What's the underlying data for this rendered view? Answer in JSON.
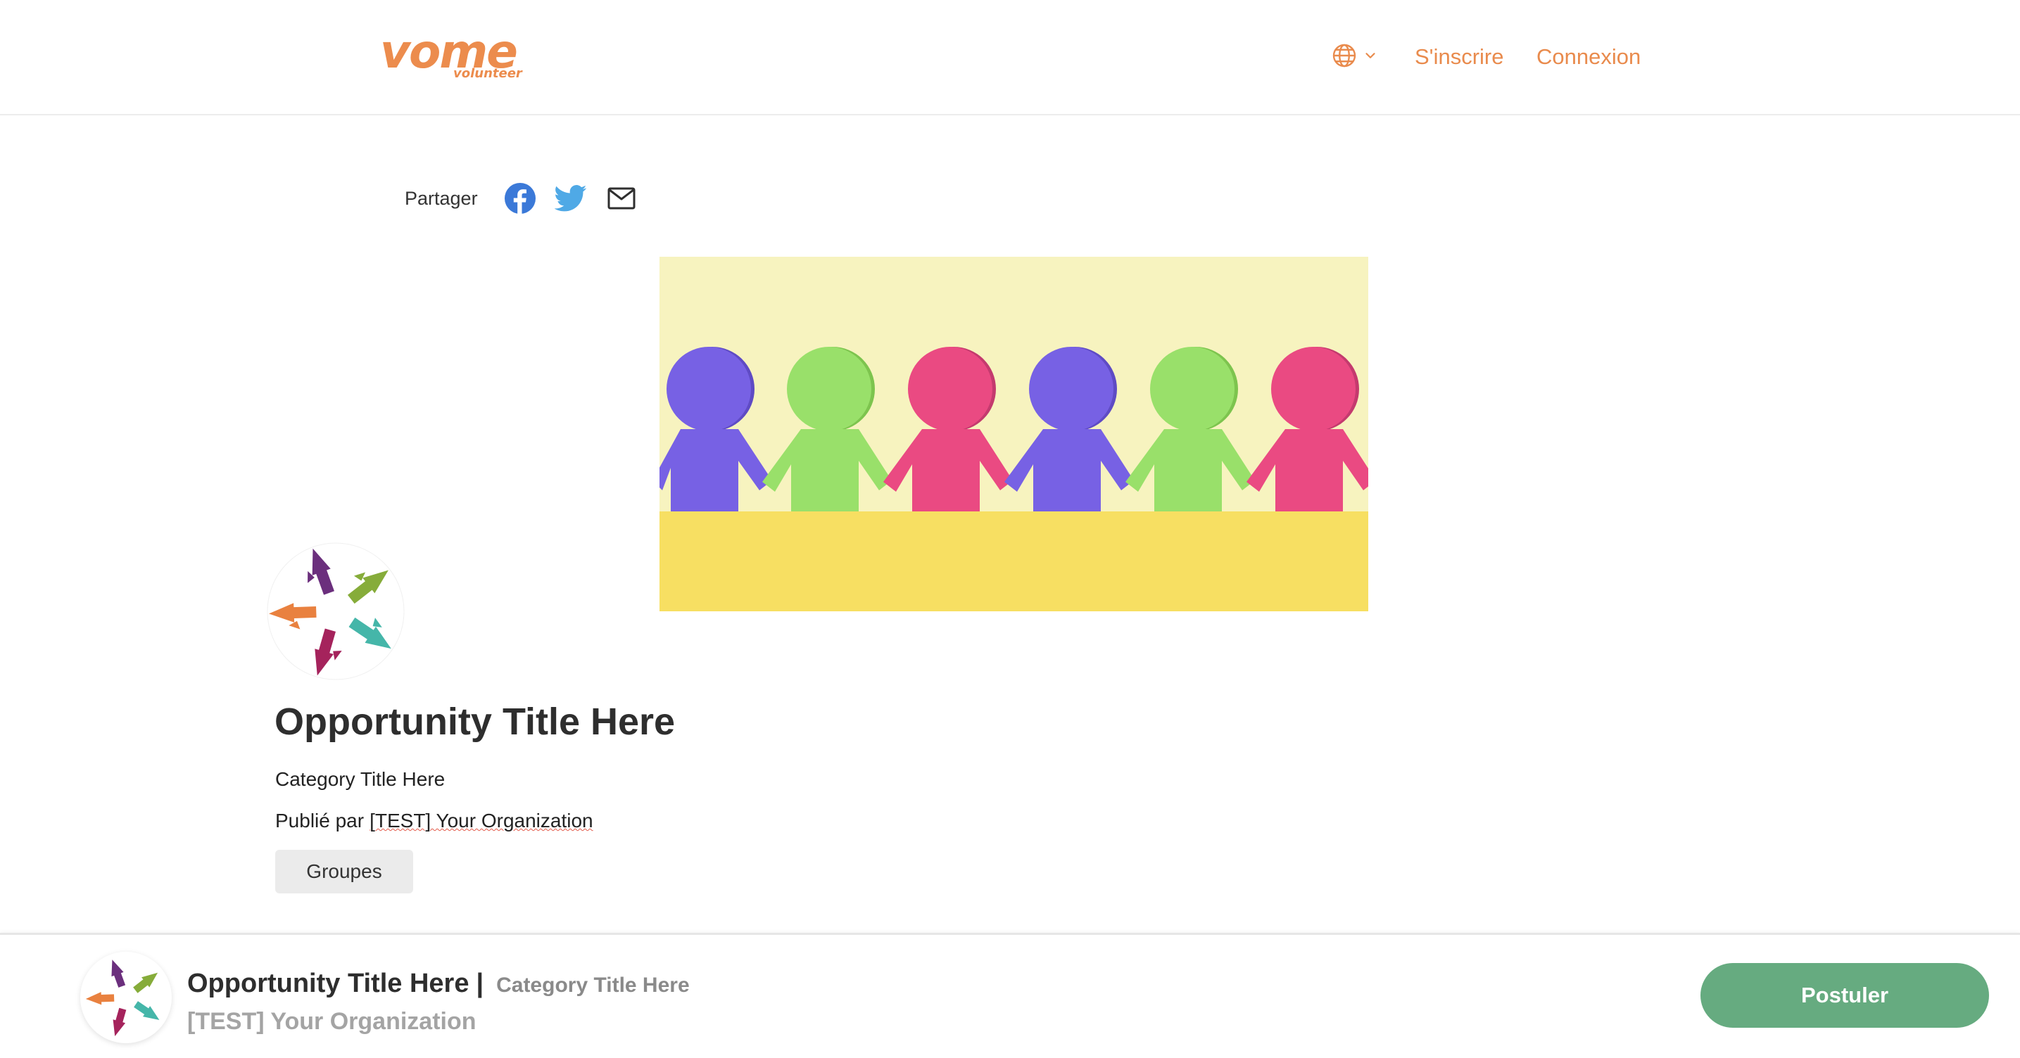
{
  "header": {
    "logo_text": "vome",
    "logo_subtext": "volunteer",
    "language_icon": "globe-icon",
    "signup_label": "S'inscrire",
    "login_label": "Connexion"
  },
  "share": {
    "label": "Partager",
    "icons": [
      "facebook-icon",
      "twitter-icon",
      "mail-icon"
    ]
  },
  "opportunity": {
    "title": "Opportunity Title Here",
    "category": "Category Title Here",
    "published_by_label": "Publié par",
    "organization": "[TEST] Your Organization",
    "groups_label": "Groupes"
  },
  "bottom_bar": {
    "title": "Opportunity Title Here",
    "separator": "|",
    "category": "Category Title Here",
    "organization": "[TEST] Your Organization",
    "apply_label": "Postuler"
  },
  "colors": {
    "brand_orange": "#ec8c4d",
    "apply_green": "#66ab80",
    "facebook_blue": "#3b79d8",
    "twitter_blue": "#4fa9e6"
  }
}
